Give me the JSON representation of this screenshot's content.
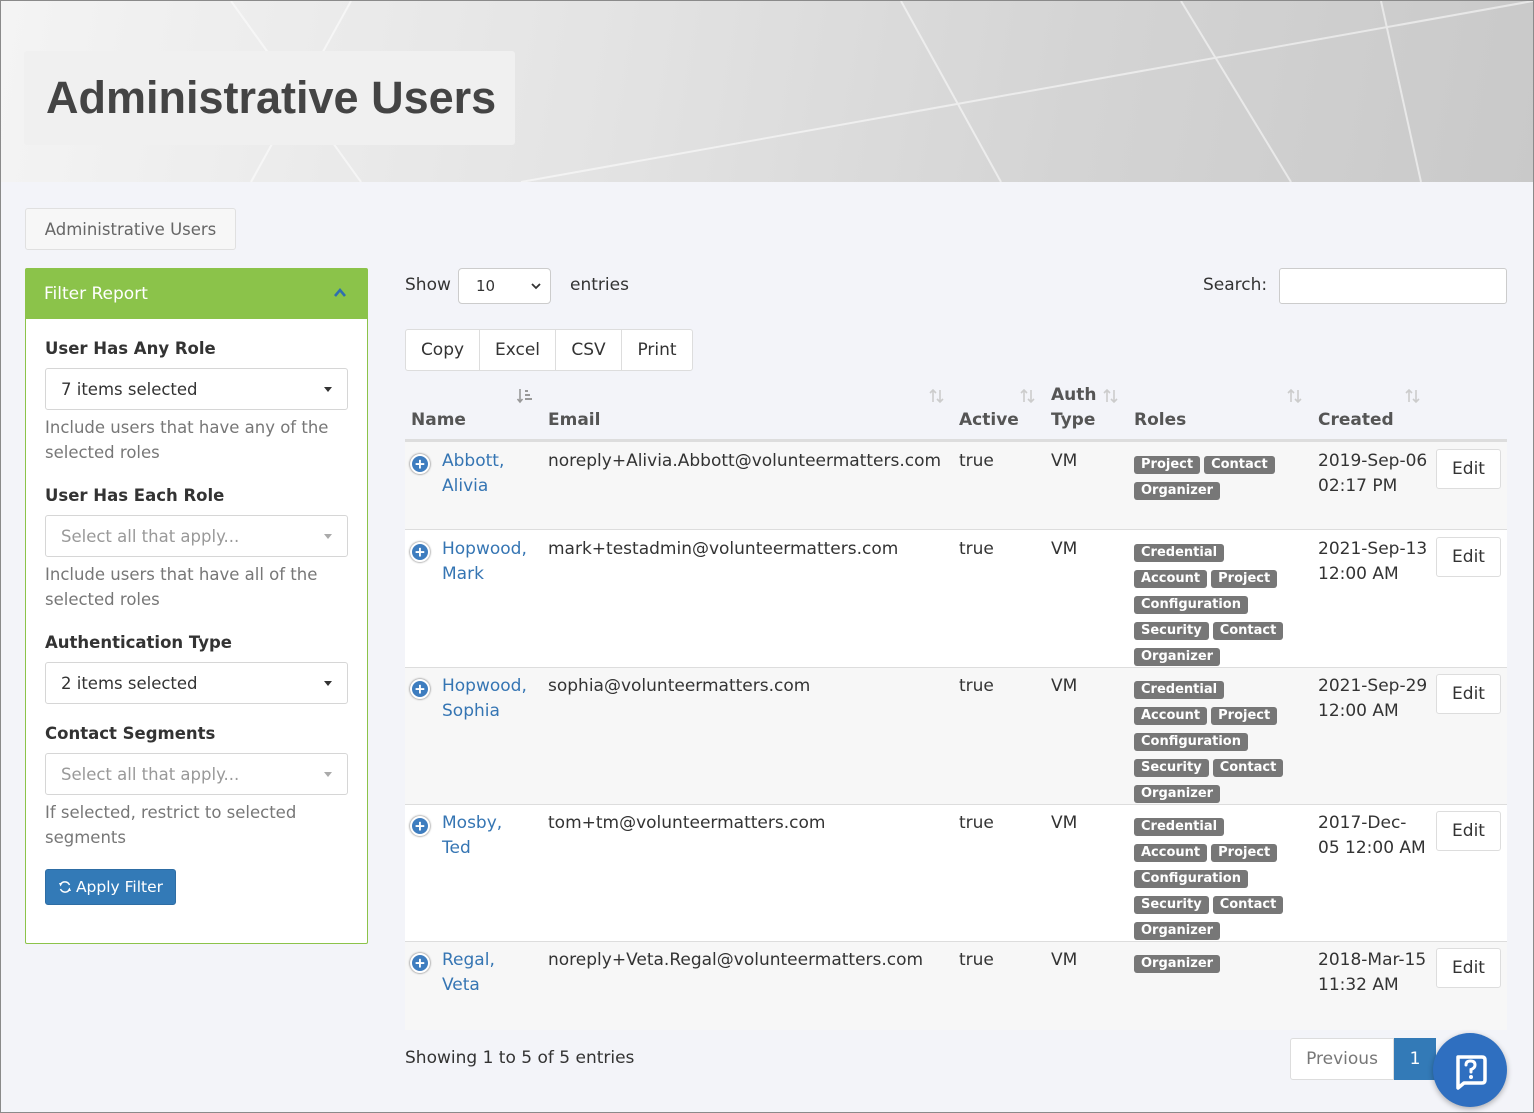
{
  "page": {
    "title": "Administrative Users",
    "breadcrumb": "Administrative Users"
  },
  "filter": {
    "heading": "Filter Report",
    "any_role": {
      "label": "User Has Any Role",
      "value": "7 items selected",
      "help": "Include users that have any of the selected roles"
    },
    "each_role": {
      "label": "User Has Each Role",
      "placeholder": "Select all that apply...",
      "help": "Include users that have all of the selected roles"
    },
    "auth_type": {
      "label": "Authentication Type",
      "value": "2 items selected"
    },
    "segments": {
      "label": "Contact Segments",
      "placeholder": "Select all that apply...",
      "help": "If selected, restrict to selected segments"
    },
    "apply_label": "Apply Filter"
  },
  "toolbar": {
    "show_label": "Show",
    "entries_value": "10",
    "entries_label": "entries",
    "search_label": "Search:",
    "buttons": [
      "Copy",
      "Excel",
      "CSV",
      "Print"
    ]
  },
  "table": {
    "headers": {
      "name": "Name",
      "email": "Email",
      "active": "Active",
      "auth_type": "Auth Type",
      "roles": "Roles",
      "created": "Created"
    },
    "edit_label": "Edit",
    "rows": [
      {
        "name": "Abbott, Alivia",
        "email": "noreply+Alivia.Abbott@volunteermatters.com",
        "active": "true",
        "auth": "VM",
        "roles": [
          "Project",
          "Contact",
          "Organizer"
        ],
        "created": "2019-Sep-06 02:17 PM"
      },
      {
        "name": "Hopwood, Mark",
        "email": "mark+testadmin@volunteermatters.com",
        "active": "true",
        "auth": "VM",
        "roles": [
          "Credential",
          "Account",
          "Project",
          "Configuration",
          "Security",
          "Contact",
          "Organizer"
        ],
        "created": "2021-Sep-13 12:00 AM"
      },
      {
        "name": "Hopwood, Sophia",
        "email": "sophia@volunteermatters.com",
        "active": "true",
        "auth": "VM",
        "roles": [
          "Credential",
          "Account",
          "Project",
          "Configuration",
          "Security",
          "Contact",
          "Organizer"
        ],
        "created": "2021-Sep-29 12:00 AM"
      },
      {
        "name": "Mosby, Ted",
        "email": "tom+tm@volunteermatters.com",
        "active": "true",
        "auth": "VM",
        "roles": [
          "Credential",
          "Account",
          "Project",
          "Configuration",
          "Security",
          "Contact",
          "Organizer"
        ],
        "created": "2017-Dec-05 12:00 AM"
      },
      {
        "name": "Regal, Veta",
        "email": "noreply+Veta.Regal@volunteermatters.com",
        "active": "true",
        "auth": "VM",
        "roles": [
          "Organizer"
        ],
        "created": "2018-Mar-15 11:32 AM"
      }
    ]
  },
  "footer": {
    "showing": "Showing 1 to 5 of 5 entries",
    "previous": "Previous",
    "page": "1"
  },
  "colors": {
    "filter_green": "#8bc34a",
    "primary_blue": "#337ab7",
    "link_blue": "#3575b3",
    "badge_gray": "#777777"
  }
}
